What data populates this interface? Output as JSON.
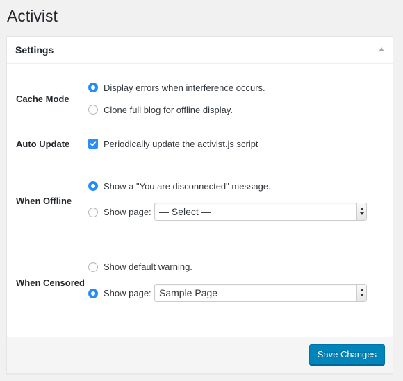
{
  "page": {
    "title": "Activist"
  },
  "settings": {
    "title": "Settings",
    "cache_mode": {
      "label": "Cache Mode",
      "options": [
        {
          "text": "Display errors when interference occurs.",
          "checked": true
        },
        {
          "text": "Clone full blog for offline display.",
          "checked": false
        }
      ]
    },
    "auto_update": {
      "label": "Auto Update",
      "checkbox_text": "Periodically update the activist.js script",
      "checked": true
    },
    "when_offline": {
      "label": "When Offline",
      "options": [
        {
          "text": "Show a \"You are disconnected\" message.",
          "checked": true
        },
        {
          "text": "Show page:",
          "checked": false
        }
      ],
      "select_value": "— Select —"
    },
    "when_censored": {
      "label": "When Censored",
      "options": [
        {
          "text": "Show default warning.",
          "checked": false
        },
        {
          "text": "Show page:",
          "checked": true
        }
      ],
      "select_value": "Sample Page"
    },
    "save_label": "Save Changes"
  },
  "colors": {
    "accent": "#2a8ef2",
    "button": "#0085ba"
  }
}
